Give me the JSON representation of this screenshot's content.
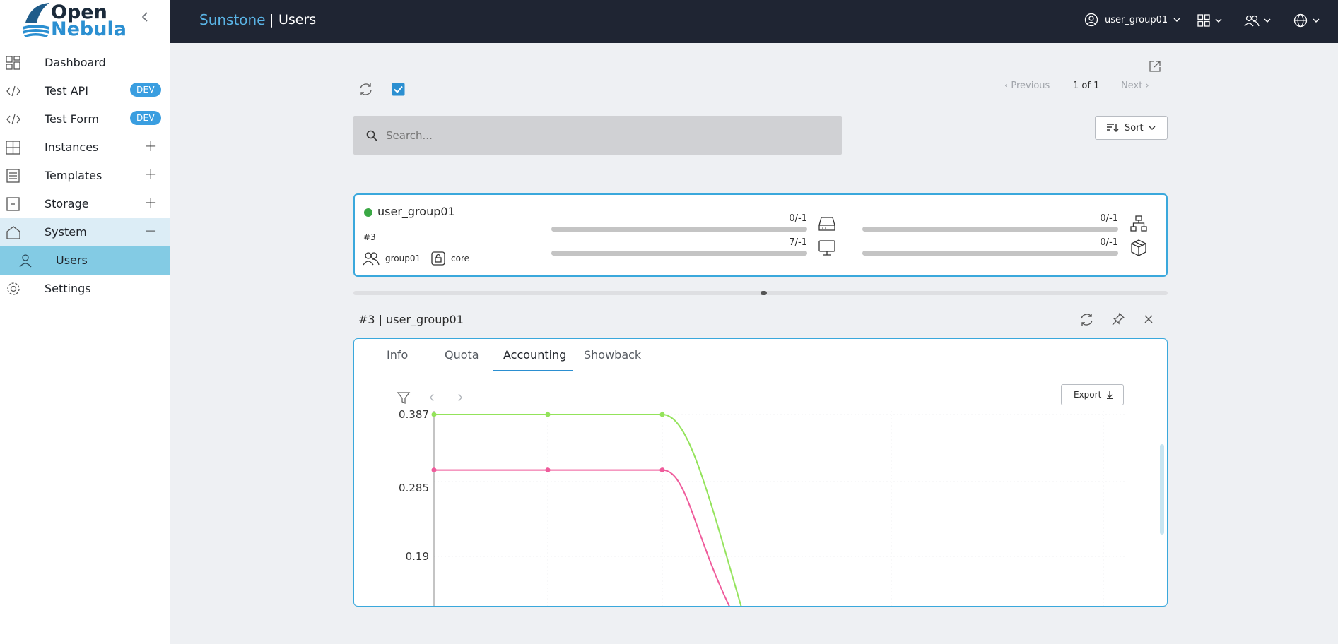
{
  "app": {
    "logo_line1": "Open",
    "logo_line2": "Nebula",
    "brand": "Sunstone",
    "separator": "|",
    "page": "Users",
    "user_menu": "user_group01"
  },
  "sidebar": {
    "items": [
      {
        "label": "Dashboard",
        "icon": "dashboard-icon"
      },
      {
        "label": "Test API",
        "icon": "code-icon",
        "badge": "DEV"
      },
      {
        "label": "Test Form",
        "icon": "code-icon",
        "badge": "DEV"
      },
      {
        "label": "Instances",
        "icon": "grid-icon",
        "toggle": "+"
      },
      {
        "label": "Templates",
        "icon": "templates-icon",
        "toggle": "+"
      },
      {
        "label": "Storage",
        "icon": "storage-icon",
        "toggle": "+"
      },
      {
        "label": "System",
        "icon": "home-icon",
        "toggle": "−"
      },
      {
        "label": "Users",
        "icon": "user-icon"
      },
      {
        "label": "Settings",
        "icon": "gear-icon"
      }
    ]
  },
  "toolbar": {
    "pager_prev": "Previous",
    "pager_info": "1 of 1",
    "pager_next": "Next",
    "search_placeholder": "Search...",
    "sort_label": "Sort"
  },
  "user_card": {
    "name": "user_group01",
    "id": "#3",
    "group": "group01",
    "auth": "core",
    "status_color": "#3aa844",
    "quotas": [
      {
        "value": "0/-1",
        "icon": "hard-drive-icon"
      },
      {
        "value": "0/-1",
        "icon": "network-icon"
      },
      {
        "value": "7/-1",
        "icon": "monitor-icon"
      },
      {
        "value": "0/-1",
        "icon": "package-icon"
      }
    ]
  },
  "detail": {
    "title": "#3 | user_group01",
    "tabs": [
      "Info",
      "Quota",
      "Accounting",
      "Showback"
    ],
    "active_tab": "Accounting",
    "export_label": "Export"
  },
  "chart_data": {
    "type": "line",
    "y_ticks": [
      "0.387",
      "0.285",
      "0.19"
    ],
    "ylim": [
      0.19,
      0.387
    ],
    "series": [
      {
        "color": "#93e35a",
        "values": [
          0.387,
          0.387,
          0.387
        ]
      },
      {
        "color": "#ef5b9b",
        "values": [
          0.31,
          0.31,
          0.31
        ]
      }
    ]
  }
}
